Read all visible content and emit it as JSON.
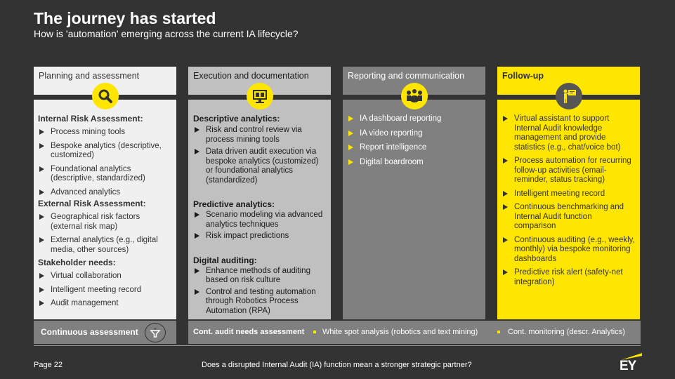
{
  "header": {
    "title": "The journey has started",
    "subtitle": "How is 'automation' emerging across the current IA lifecycle?"
  },
  "colors": {
    "background": "#333333",
    "accent_yellow": "#ffe600",
    "col1_bg": "#f0f0f0",
    "col2_bg": "#c0c0c0",
    "col3_bg": "#808080",
    "col4_bg": "#ffe600"
  },
  "columns": [
    {
      "title": "Planning and assessment",
      "icon": "magnifier-icon",
      "sections": [
        {
          "heading": "Internal Risk Assessment:",
          "items": [
            "Process mining tools",
            "Bespoke analytics (descriptive, customized)",
            "Foundational analytics (descriptive, standardized)",
            "Advanced analytics"
          ]
        },
        {
          "heading": "External Risk Assessment:",
          "items": [
            "Geographical risk factors (external risk map)",
            "External analytics (e.g., digital media, other sources)"
          ]
        },
        {
          "heading": "Stakeholder needs:",
          "items": [
            "Virtual collaboration",
            "Intelligent meeting record",
            "Audit management"
          ]
        }
      ]
    },
    {
      "title": "Execution and documentation",
      "icon": "monitor-chart-icon",
      "sections": [
        {
          "heading": "Descriptive analytics:",
          "items": [
            "Risk and control review via process mining tools",
            "Data driven audit execution via bespoke analytics (customized) or foundational analytics (standardized)"
          ]
        },
        {
          "heading": "Predictive analytics:",
          "items": [
            "Scenario modeling via advanced analytics techniques",
            "Risk impact predictions"
          ]
        },
        {
          "heading": "Digital auditing:",
          "items": [
            "Enhance methods of auditing based on risk culture",
            "Control and testing automation through Robotics Process Automation (RPA)"
          ]
        }
      ]
    },
    {
      "title": "Reporting and communication",
      "icon": "meeting-icon",
      "items": [
        "IA dashboard reporting",
        "IA video reporting",
        "Report intelligence",
        "Digital boardroom"
      ]
    },
    {
      "title": "Follow-up",
      "icon": "presenter-icon",
      "items": [
        "Virtual assistant to support Internal Audit knowledge management and provide statistics (e.g., chat/voice bot)",
        "Process automation for recurring follow-up activities (email-reminder, status tracking)",
        "Intelligent meeting record",
        "Continuous benchmarking and Internal Audit function comparison",
        "Continuous auditing (e.g., weekly, monthly) via bespoke monitoring dashboards",
        "Predictive risk alert (safety-net integration)"
      ]
    }
  ],
  "bottom_bar": {
    "continuous_assessment": "Continuous assessment",
    "cont_audit": "Cont. audit needs assessment",
    "white_spot": "White spot analysis (robotics and text mining)",
    "cont_monitoring": "Cont. monitoring (descr. Analytics)"
  },
  "footer": {
    "page": "Page 22",
    "question": "Does a disrupted Internal Audit (IA) function mean a stronger strategic partner?",
    "logo": "EY"
  }
}
